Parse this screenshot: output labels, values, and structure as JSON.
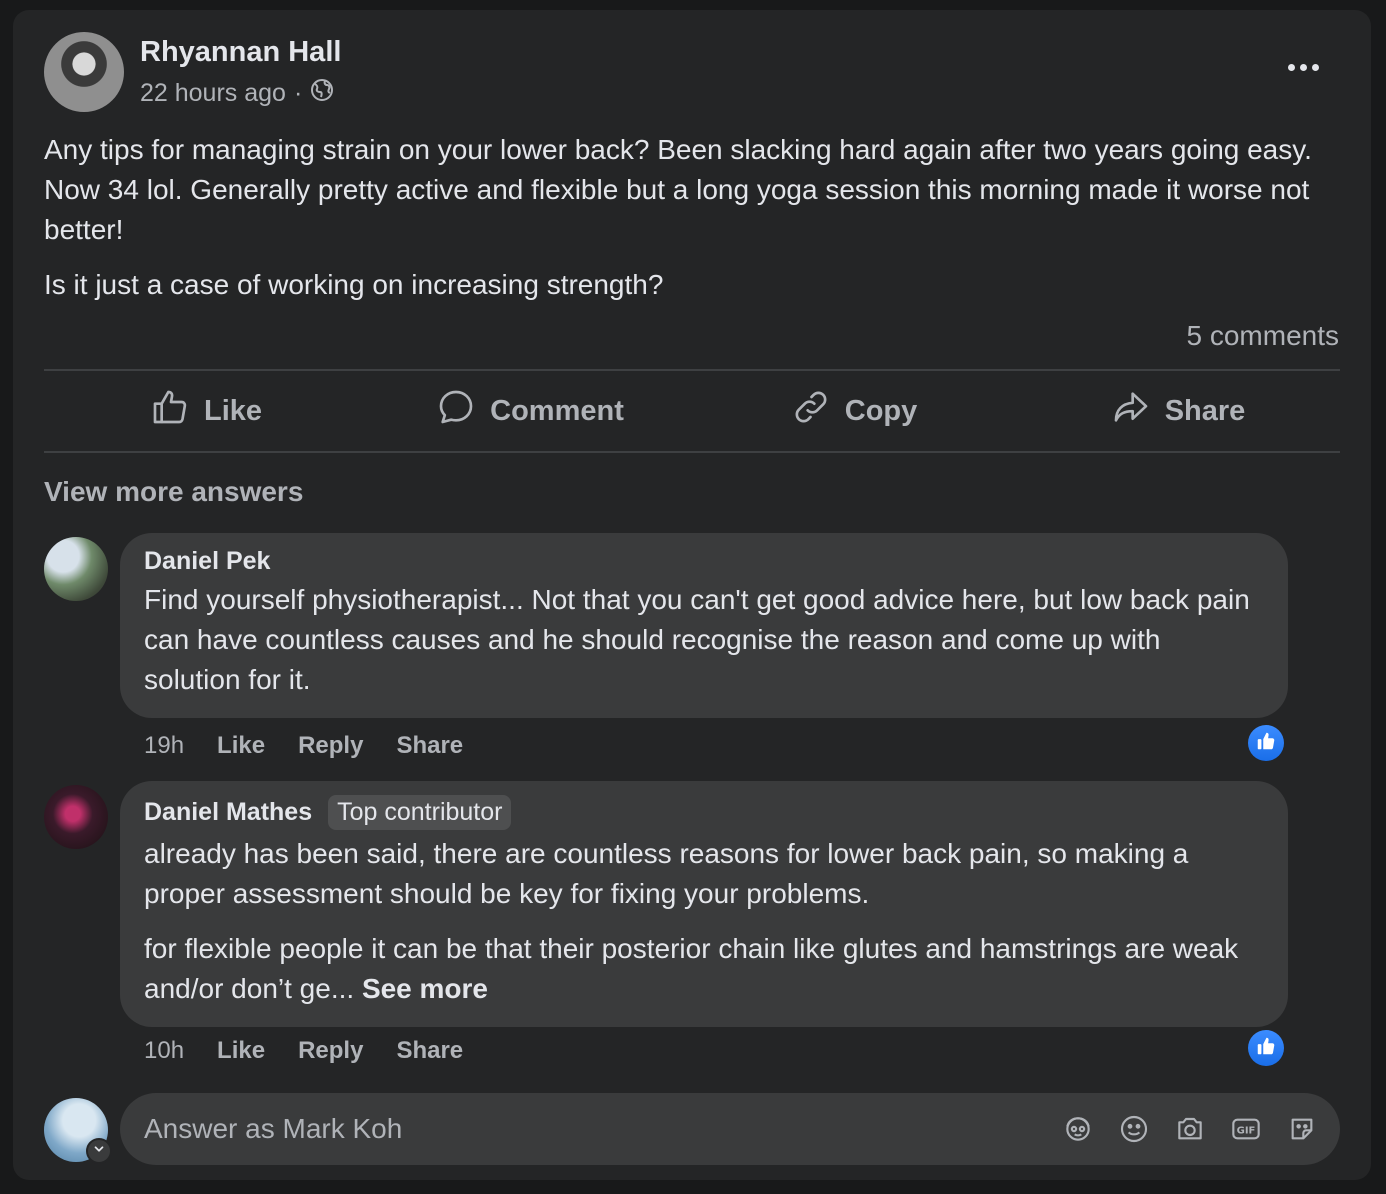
{
  "post": {
    "author": "Rhyannan Hall",
    "time": "22 hours ago",
    "separator": "·",
    "privacy_icon": "globe-icon",
    "paragraphs": [
      "Any tips for managing strain on your lower back? Been slacking hard again after two years going easy. Now 34 lol. Generally pretty active and flexible but a long yoga session this morning made it worse not better!",
      "Is it just a case of working on increasing strength?"
    ],
    "comments_count": "5 comments"
  },
  "actions": {
    "like": "Like",
    "comment": "Comment",
    "copy": "Copy",
    "share": "Share"
  },
  "view_more": "View more answers",
  "comments": [
    {
      "name": "Daniel Pek",
      "badge": "",
      "paragraphs": [
        "Find yourself physiotherapist... Not that you can't get good advice here, but low back pain can have countless causes and he should recognise the reason and come up with solution for it."
      ],
      "time": "19h",
      "like": "Like",
      "reply": "Reply",
      "share": "Share",
      "reaction_icon": "thumbs-up-icon"
    },
    {
      "name": "Daniel Mathes",
      "badge": "Top contributor",
      "paragraphs": [
        "already has been said, there are countless reasons for lower back pain, so making a proper assessment should be key for fixing your problems.",
        "for flexible people it can be that their posterior chain like glutes and hamstrings are weak and/or don’t ge..."
      ],
      "see_more": "See more",
      "time": "10h",
      "like": "Like",
      "reply": "Reply",
      "share": "Share",
      "reaction_icon": "thumbs-up-icon"
    }
  ],
  "composer": {
    "placeholder": "Answer as Mark Koh",
    "icons": [
      "avatar-sticker-icon",
      "emoji-icon",
      "camera-icon",
      "gif-icon",
      "sticker-icon"
    ]
  },
  "colors": {
    "background": "#18191a",
    "card": "#242526",
    "bubble": "#3a3b3c",
    "text_primary": "#e4e6eb",
    "text_secondary": "#b0b3b8",
    "like_blue": "#1a6ee8"
  }
}
